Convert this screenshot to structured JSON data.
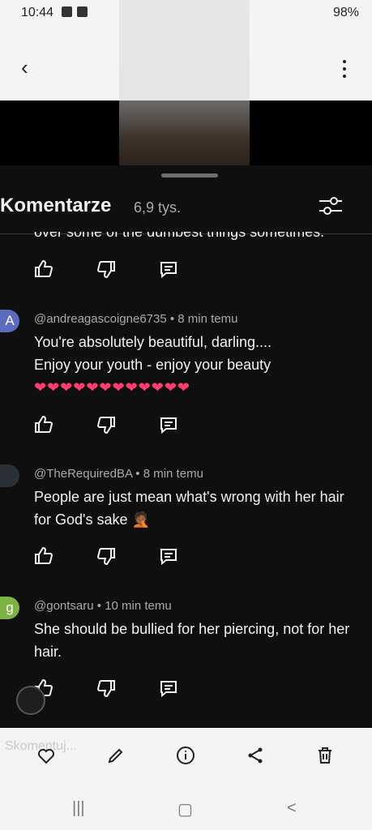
{
  "status": {
    "time": "10:44",
    "battery": "98%"
  },
  "sheet": {
    "title": "Komentarze",
    "count": "6,9 tys.",
    "partial_text": "over some of the dumbest things sometimes."
  },
  "comments": [
    {
      "initial": "A",
      "avatar_color": "#5c6bc0",
      "meta": "@andreagascoigne6735 • 8 min temu",
      "lines": [
        "You're absolutely beautiful, darling....",
        "Enjoy your youth - enjoy your beauty"
      ],
      "hearts": "❤❤❤❤❤❤❤❤❤❤❤❤"
    },
    {
      "initial": "",
      "avatar_color": "#2b2f36",
      "meta": "@TheRequiredBA • 8 min temu",
      "lines": [
        "People are just mean what's wrong with her hair",
        "for God's sake 🤦🏾"
      ]
    },
    {
      "initial": "g",
      "avatar_color": "#7cb342",
      "meta": "@gontsaru • 10 min temu",
      "lines": [
        "She should be bullied for her piercing, not for her",
        "hair."
      ]
    }
  ],
  "bottom": {
    "input_placeholder": "Skomentuj..."
  },
  "nav": {
    "recent": "|||",
    "home": "▢",
    "back": "<"
  }
}
